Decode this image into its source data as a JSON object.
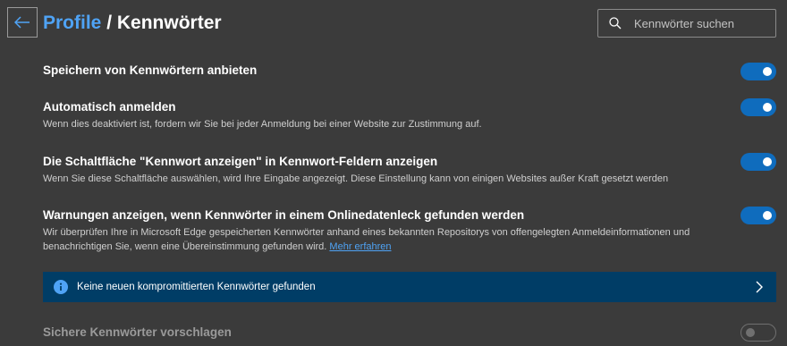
{
  "header": {
    "breadcrumb_link": "Profile",
    "separator": " / ",
    "page_title": "Kennwörter",
    "search_placeholder": "Kennwörter suchen"
  },
  "settings": [
    {
      "title": "Speichern von Kennwörtern anbieten",
      "description": "",
      "enabled": true
    },
    {
      "title": "Automatisch anmelden",
      "description": "Wenn dies deaktiviert ist, fordern wir Sie bei jeder Anmeldung bei einer Website zur Zustimmung auf.",
      "enabled": true
    },
    {
      "title": "Die Schaltfläche \"Kennwort anzeigen\" in Kennwort-Feldern anzeigen",
      "description": "Wenn Sie diese Schaltfläche auswählen, wird Ihre Eingabe angezeigt. Diese Einstellung kann von einigen Websites außer Kraft gesetzt werden",
      "enabled": true
    },
    {
      "title": "Warnungen anzeigen, wenn Kennwörter in einem Onlinedatenleck gefunden werden",
      "description": "Wir überprüfen Ihre in Microsoft Edge gespeicherten Kennwörter anhand eines bekannten Repositorys von offengelegten Anmeldeinformationen und benachrichtigen Sie, wenn eine Übereinstimmung gefunden wird.",
      "link": "Mehr erfahren",
      "enabled": true
    },
    {
      "title": "Sichere Kennwörter vorschlagen",
      "description": "",
      "enabled": false
    }
  ],
  "banner": {
    "text": "Keine neuen kompromittierten Kennwörter gefunden"
  },
  "colors": {
    "accent": "#0f6cbd",
    "link": "#4fa3f5",
    "banner_bg": "#003d66",
    "background": "#3b3b3b"
  },
  "icons": [
    "back-arrow-icon",
    "search-icon",
    "info-icon",
    "chevron-right-icon"
  ]
}
